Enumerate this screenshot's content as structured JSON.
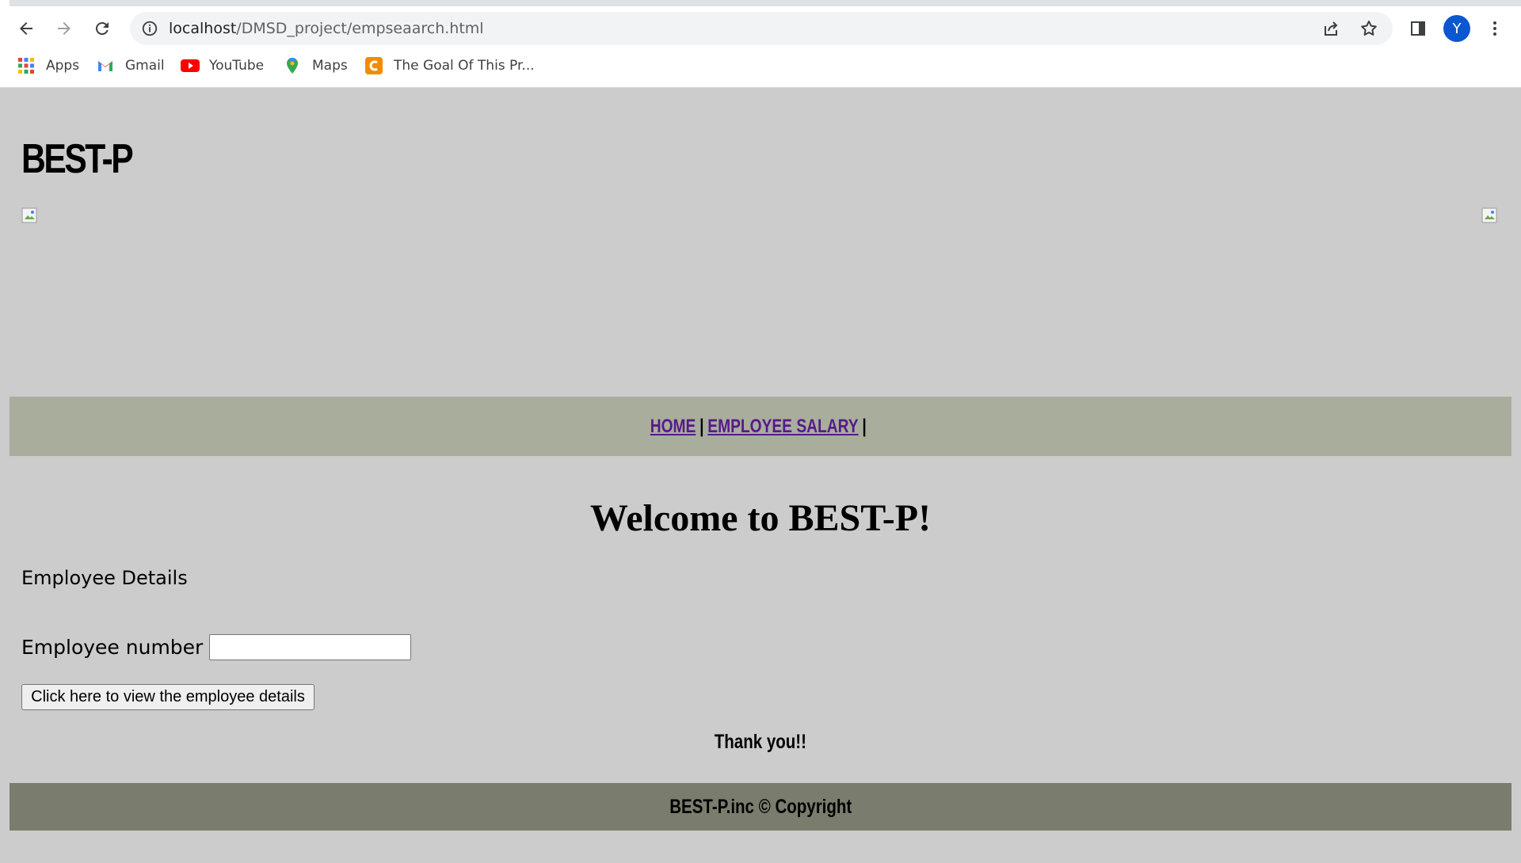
{
  "browser": {
    "url_host": "localhost",
    "url_path": "/DMSD_project/empseaarch.html",
    "profile_initial": "Y",
    "bookmarks": [
      {
        "label": "Apps",
        "icon": "apps-grid-icon"
      },
      {
        "label": "Gmail",
        "icon": "gmail-icon"
      },
      {
        "label": "YouTube",
        "icon": "youtube-icon"
      },
      {
        "label": "Maps",
        "icon": "maps-icon"
      },
      {
        "label": "The Goal Of This Pr...",
        "icon": "c-favicon-icon"
      }
    ]
  },
  "page": {
    "site_title": "BEST-P",
    "nav": {
      "home": "HOME",
      "separator": "|",
      "employee_salary": "EMPLOYEE SALARY"
    },
    "welcome": "Welcome to BEST-P!",
    "section_label": "Employee Details",
    "employee_number_label": "Employee number",
    "employee_number_value": "",
    "submit_label": "Click here to view the employee details",
    "thanks": "Thank you!!",
    "footer": "BEST-P.inc © Copyright"
  },
  "colors": {
    "page_bg": "#cccccc",
    "nav_band": "#a9ad9c",
    "footer_band": "#7a7d6d",
    "link_visited": "#551a8b"
  }
}
